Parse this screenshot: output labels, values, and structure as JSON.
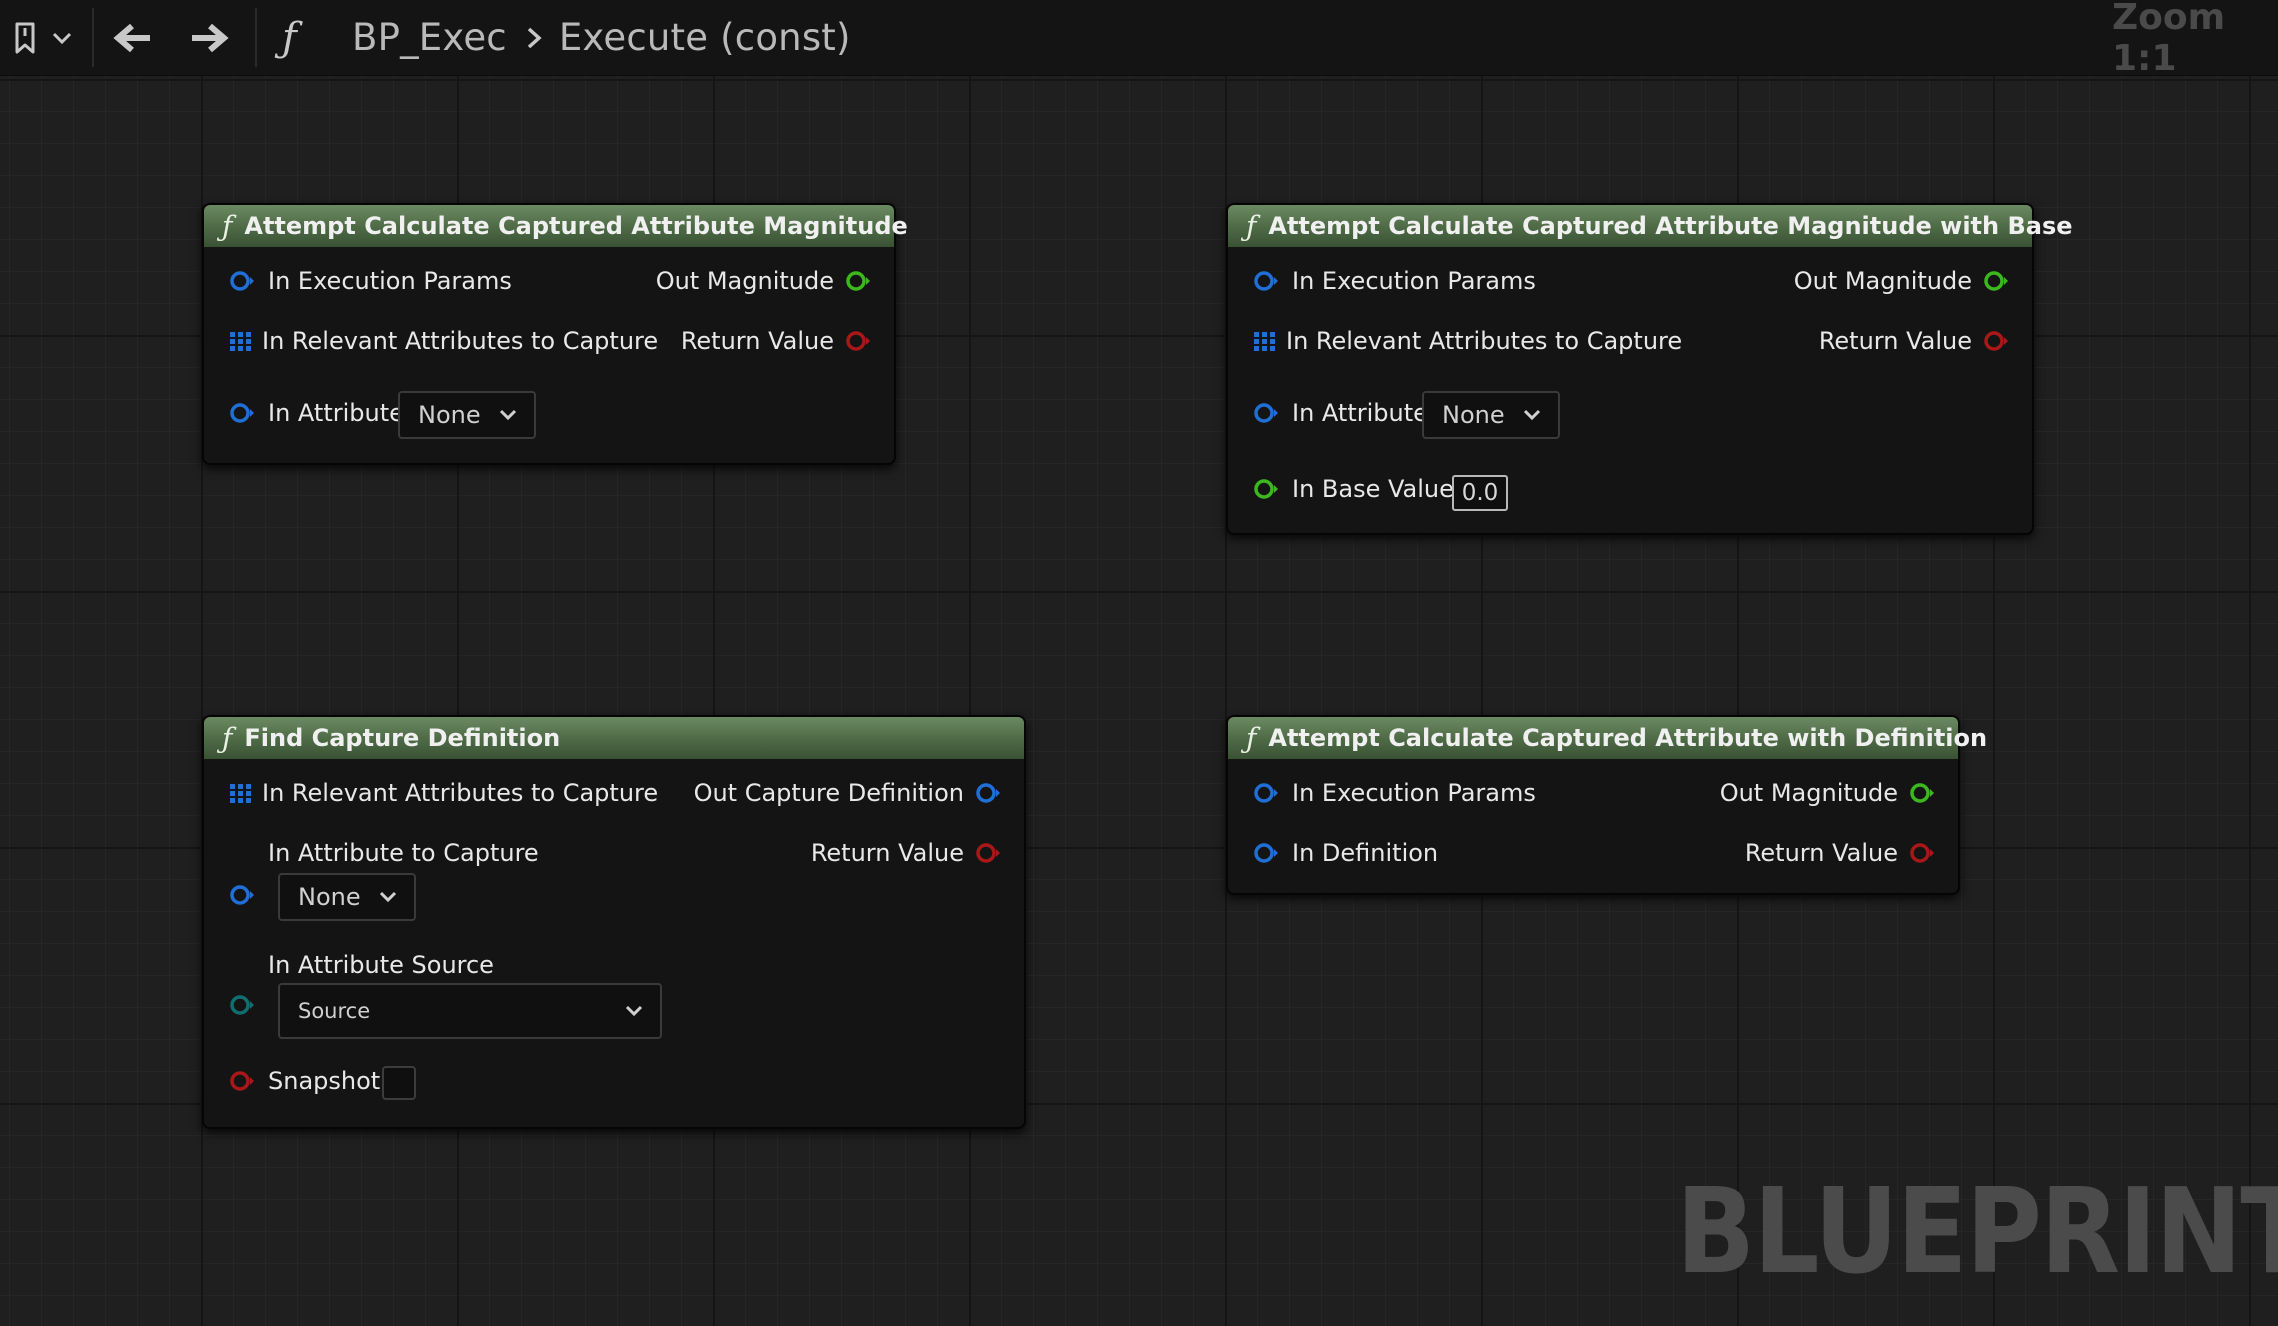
{
  "toolbar": {
    "icons": [
      "bookmark-icon",
      "chevron-down-icon",
      "back-arrow-icon",
      "forward-arrow-icon",
      "function-icon",
      "breadcrumb-chevron-icon"
    ],
    "breadcrumb": [
      "BP_Exec",
      "Execute (const)"
    ],
    "zoom": "Zoom 1:1"
  },
  "colors": {
    "node_header": "#4f6c47",
    "pin_struct": "#1f6fd6",
    "pin_float": "#3cb81e",
    "pin_bool": "#a81818",
    "pin_enum": "#106e70"
  },
  "nodes": [
    {
      "title": "Attempt Calculate Captured Attribute Magnitude",
      "inputs": [
        {
          "label": "In Execution Params",
          "type": "struct"
        },
        {
          "label": "In Relevant Attributes to Capture",
          "type": "array"
        },
        {
          "label": "In Attribute",
          "type": "struct",
          "value": "None"
        }
      ],
      "outputs": [
        {
          "label": "Out Magnitude",
          "type": "float"
        },
        {
          "label": "Return Value",
          "type": "bool"
        }
      ]
    },
    {
      "title": "Attempt Calculate Captured Attribute Magnitude with Base",
      "inputs": [
        {
          "label": "In Execution Params",
          "type": "struct"
        },
        {
          "label": "In Relevant Attributes to Capture",
          "type": "array"
        },
        {
          "label": "In Attribute",
          "type": "struct",
          "value": "None"
        },
        {
          "label": "In Base Value",
          "type": "float",
          "value": "0.0"
        }
      ],
      "outputs": [
        {
          "label": "Out Magnitude",
          "type": "float"
        },
        {
          "label": "Return Value",
          "type": "bool"
        }
      ]
    },
    {
      "title": "Find Capture Definition",
      "inputs": [
        {
          "label": "In Relevant Attributes to Capture",
          "type": "array"
        },
        {
          "label": "In Attribute to Capture",
          "type": "struct",
          "value": "None"
        },
        {
          "label": "In Attribute Source",
          "type": "enum",
          "value": "Source"
        },
        {
          "label": "Snapshot",
          "type": "bool",
          "value": false
        }
      ],
      "outputs": [
        {
          "label": "Out Capture Definition",
          "type": "struct"
        },
        {
          "label": "Return Value",
          "type": "bool"
        }
      ]
    },
    {
      "title": "Attempt Calculate Captured Attribute with Definition",
      "inputs": [
        {
          "label": "In Execution Params",
          "type": "struct"
        },
        {
          "label": "In Definition",
          "type": "struct"
        }
      ],
      "outputs": [
        {
          "label": "Out Magnitude",
          "type": "float"
        },
        {
          "label": "Return Value",
          "type": "bool"
        }
      ]
    }
  ],
  "watermark": "BLUEPRINT"
}
